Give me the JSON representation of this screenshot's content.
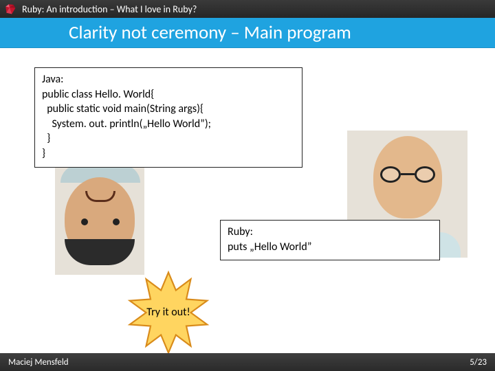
{
  "header": {
    "title": "Ruby: An introduction – What I love in Ruby?",
    "subtitle": "Clarity not ceremony – Main program"
  },
  "code": {
    "java": {
      "label": "Java:",
      "l1": "public class Hello. World{",
      "l2": "  public static void main(String args){",
      "l3": "    System. out. println(„Hello World”);",
      "l4": "  }",
      "l5": "}"
    },
    "ruby": {
      "label": "Ruby:",
      "l1": "puts „Hello World”"
    }
  },
  "callout": {
    "text": "Try it out!"
  },
  "footer": {
    "author": "Maciej Mensfeld",
    "page": "5/23"
  },
  "colors": {
    "band": "#1fa3e0",
    "burst_fill": "#ffd560",
    "burst_stroke": "#d98b1a"
  }
}
